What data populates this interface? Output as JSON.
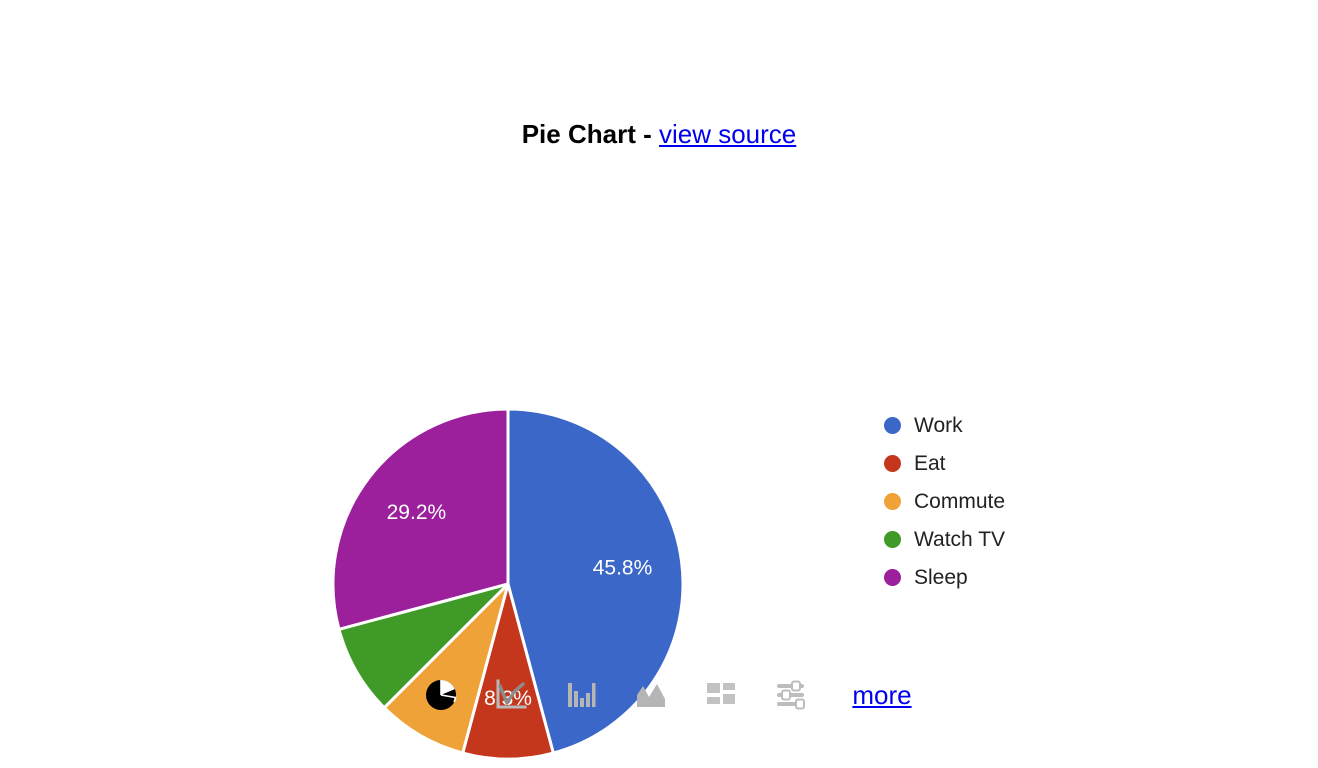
{
  "header": {
    "title": "Pie Chart",
    "separator": "-",
    "view_source_label": "view source"
  },
  "chart_data": {
    "type": "pie",
    "title": "Pie Chart",
    "xlabel": "",
    "ylabel": "",
    "legend_position": "right",
    "grid": false,
    "categories": [
      "Work",
      "Eat",
      "Commute",
      "Watch TV",
      "Sleep"
    ],
    "values": [
      11,
      2,
      2,
      2,
      7
    ],
    "percentages": [
      45.8,
      8.3,
      8.3,
      8.3,
      29.2
    ],
    "colors": [
      "#3b67c8",
      "#c5371d",
      "#efa238",
      "#3f9a28",
      "#9c209c"
    ],
    "data_labels": [
      "45.8%",
      "",
      "",
      "",
      "29.2%"
    ],
    "visible_labels": [
      {
        "text": "45.8%",
        "category": "Work"
      },
      {
        "text": "8.3%",
        "category": "Eat"
      },
      {
        "text": "29.2%",
        "category": "Sleep"
      }
    ],
    "start_angle_deg": 0,
    "direction": "clockwise"
  },
  "legend": {
    "items": [
      {
        "label": "Work",
        "color": "#3b67c8"
      },
      {
        "label": "Eat",
        "color": "#c5371d"
      },
      {
        "label": "Commute",
        "color": "#efa238"
      },
      {
        "label": "Watch TV",
        "color": "#3f9a28"
      },
      {
        "label": "Sleep",
        "color": "#9c209c"
      }
    ]
  },
  "toolbar": {
    "icons": [
      {
        "name": "pie-chart-icon",
        "active": true
      },
      {
        "name": "line-chart-icon",
        "active": false
      },
      {
        "name": "column-chart-icon",
        "active": false
      },
      {
        "name": "area-chart-icon",
        "active": false
      },
      {
        "name": "table-grid-icon",
        "active": false
      },
      {
        "name": "controls-sliders-icon",
        "active": false
      }
    ],
    "more_label": "more"
  }
}
